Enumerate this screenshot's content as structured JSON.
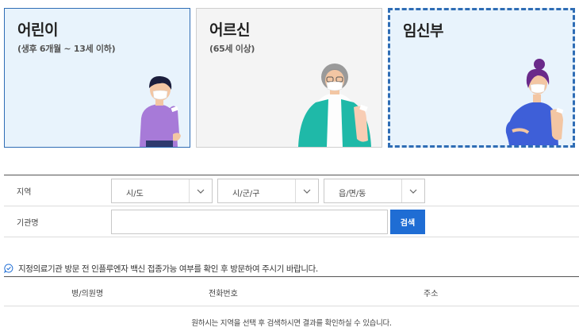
{
  "categories": [
    {
      "title": "어린이",
      "subtitle": "(생후 6개월 ~ 13세 이하)"
    },
    {
      "title": "어르신",
      "subtitle": "(65세 이상)"
    },
    {
      "title": "임신부",
      "subtitle": ""
    }
  ],
  "form": {
    "region_label": "지역",
    "selects": [
      "시/도",
      "시/군/구",
      "읍/면/동"
    ],
    "institution_label": "기관명",
    "institution_value": "",
    "search_label": "검색"
  },
  "notice": {
    "icon": "chat-check-icon",
    "text": "지정의료기관 방문 전 인플루엔자 백신 접종가능 여부를 확인 후 방문하여 주시기 바랍니다."
  },
  "table": {
    "headers": [
      "병/의원명",
      "전화번호",
      "주소"
    ],
    "empty_message": "원하시는 지역을 선택 후 검색하시면 결과를 확인하실 수 있습니다."
  },
  "colors": {
    "accent_blue": "#1f6dd4",
    "card_blue_bg": "#e8f3fc",
    "card_gray_bg": "#f4f4f4",
    "card_border_blue": "#2f6db5"
  }
}
